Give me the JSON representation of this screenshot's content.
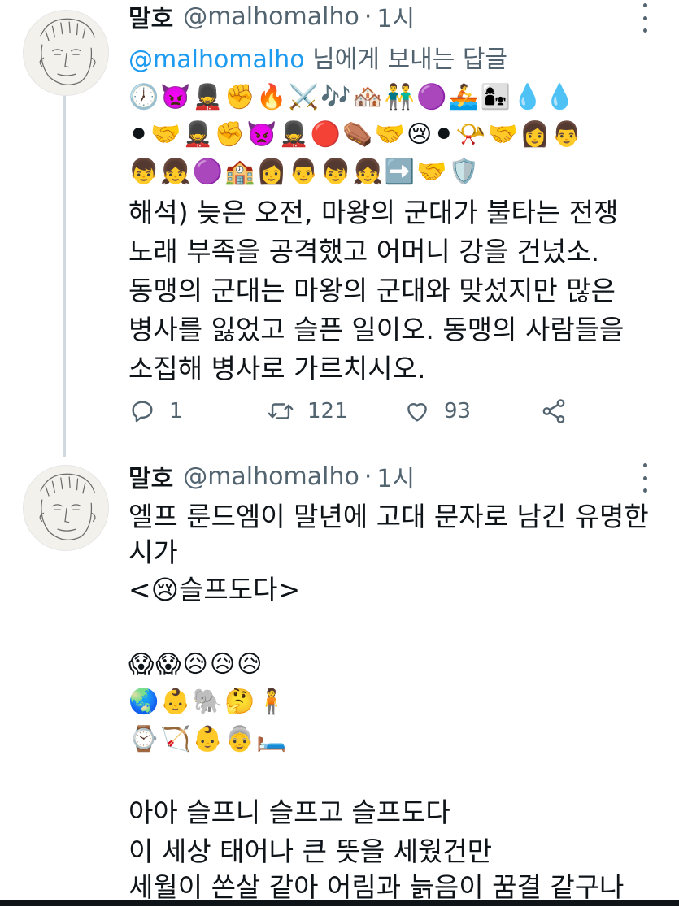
{
  "tweets": [
    {
      "name": "말호",
      "handle": "@malhomalho",
      "dot": "·",
      "time": "1시",
      "reply_prefix": "",
      "reply_mention": "@malhomalho",
      "reply_suffix": " 님에게 보내는 답글",
      "emoji_lines": [
        "🕖👿💂✊🔥⚔️🎶🏘️👬🟣🚣👩‍👧💧💧",
        "⚫🤝💂✊👿💂🔴⚰️🤝😢⚫📯🤝👩👨",
        "👦👧🟣🏫👩👨👦👧➡️🤝🛡️"
      ],
      "text_lines": [
        "해석) 늦은 오전, 마왕의 군대가 불타는 전쟁",
        "노래 부족을 공격했고 어머니 강을 건넜소.",
        "동맹의 군대는 마왕의 군대와 맞섰지만 많은",
        "병사를 잃었고 슬픈 일이오. 동맹의 사람들을",
        "소집해 병사로 가르치시오."
      ],
      "actions": {
        "replies": "1",
        "retweets": "121",
        "likes": "93"
      }
    },
    {
      "name": "말호",
      "handle": "@malhomalho",
      "dot": "·",
      "time": "1시",
      "text_lines": [
        "엘프 룬드엠이 말년에 고대 문자로 남긴 유명한",
        "시가",
        "<😢슬프도다>"
      ],
      "emoji_lines": [
        "😱😱😥😥😥",
        "🌏👶🐘🤔🧍",
        "⌚🏹👶👵🛏️"
      ],
      "poem_lines": [
        "아아 슬프니 슬프고 슬프도다",
        "이 세상 태어나 큰 뜻을 세웠건만",
        "세월이 쏜살 같아 어림과 늙음이 꿈결 같구나"
      ]
    }
  ],
  "icons": {
    "reply": "speech-bubble-icon",
    "retweet": "retweet-icon",
    "like": "heart-icon",
    "share": "share-icon",
    "more": "more-vertical-icon"
  },
  "colors": {
    "accent": "#1d9bf0",
    "secondary": "#536471",
    "text": "#0f1419",
    "thread": "#cfd9de"
  }
}
